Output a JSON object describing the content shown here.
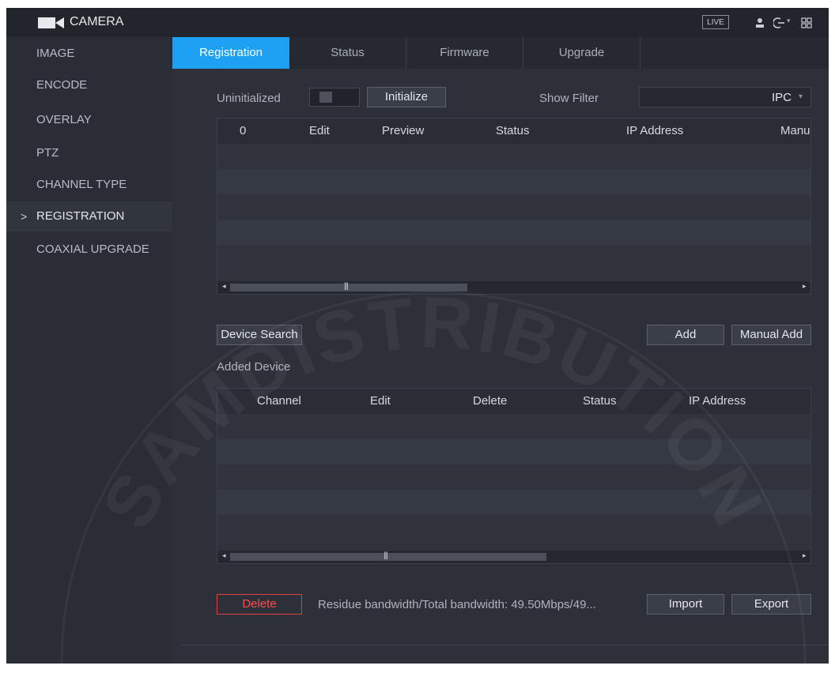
{
  "app": {
    "title": "CAMERA",
    "live_badge": "LIVE"
  },
  "header_icons": [
    "camera-icon",
    "user-icon",
    "logout-icon",
    "menu-grid-icon"
  ],
  "sidebar": {
    "items": [
      {
        "label": "IMAGE"
      },
      {
        "label": "ENCODE"
      },
      {
        "label": "OVERLAY"
      },
      {
        "label": "PTZ"
      },
      {
        "label": "CHANNEL TYPE"
      },
      {
        "label": "REGISTRATION",
        "active": true,
        "chevron": ">"
      },
      {
        "label": "COAXIAL UPGRADE"
      }
    ]
  },
  "tabs": [
    {
      "label": "Registration",
      "active": true
    },
    {
      "label": "Status"
    },
    {
      "label": "Firmware"
    },
    {
      "label": "Upgrade"
    }
  ],
  "controls": {
    "uninitialized_label": "Uninitialized",
    "initialize_button": "Initialize",
    "show_filter_label": "Show Filter",
    "show_filter_value": "IPC"
  },
  "search_table": {
    "columns": [
      "0",
      "Edit",
      "Preview",
      "Status",
      "IP Address",
      "Manu"
    ]
  },
  "actions": {
    "device_search": "Device Search",
    "add": "Add",
    "manual_add": "Manual Add",
    "added_device_label": "Added Device"
  },
  "added_table": {
    "columns": [
      "Channel",
      "Edit",
      "Delete",
      "Status",
      "IP Address"
    ]
  },
  "footer": {
    "delete_button": "Delete",
    "bandwidth_label": "Residue bandwidth/Total bandwidth:",
    "bandwidth_value": "49.50Mbps/49...",
    "import_button": "Import",
    "export_button": "Export"
  },
  "watermark_text": "SAMDISTRIBUTION",
  "colors": {
    "accent": "#1ea1f2",
    "danger": "#e0413f",
    "background": "#2d3039"
  }
}
